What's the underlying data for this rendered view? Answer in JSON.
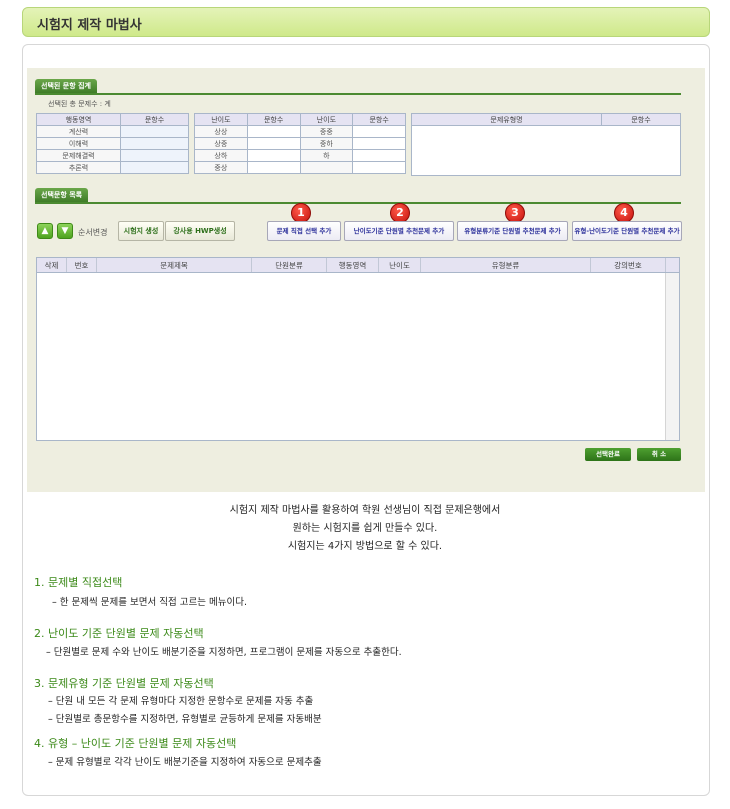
{
  "header": {
    "title": "시험지 제작 마법사"
  },
  "summary": {
    "tab_label": "선택된 문항 집계",
    "total_label": "선택된 총 문제수 : 계",
    "table1": {
      "headers": [
        "행동영역",
        "문항수"
      ],
      "rows": [
        "계산력",
        "이해력",
        "문제해결력",
        "추론력"
      ]
    },
    "table2": {
      "headers": [
        "난이도",
        "문항수",
        "난이도",
        "문항수"
      ],
      "rows": [
        [
          "상상",
          "",
          "중중",
          ""
        ],
        [
          "상중",
          "",
          "중하",
          ""
        ],
        [
          "상하",
          "",
          "하",
          ""
        ],
        [
          "중상",
          "",
          "",
          ""
        ]
      ]
    },
    "table3": {
      "headers": [
        "문제유형명",
        "문항수"
      ]
    }
  },
  "list": {
    "tab_label": "선택문항 목록",
    "order_label": "순서변경",
    "gen_button": "시험지 생성",
    "hwp_button": "강사용 HWP생성",
    "add_buttons": [
      {
        "num": "1",
        "label": "문제 직접 선택 추가"
      },
      {
        "num": "2",
        "label": "난이도기준 단원별 추천문제 추가"
      },
      {
        "num": "3",
        "label": "유형분류기준 단원별 추천문제 추가"
      },
      {
        "num": "4",
        "label": "유형-난이도기준 단원별 추천문제 추가"
      }
    ],
    "columns": [
      "삭제",
      "번호",
      "문제제목",
      "단원분류",
      "행동영역",
      "난이도",
      "유형분류",
      "강의번호"
    ],
    "confirm_button": "선택완료",
    "cancel_button": "취 소"
  },
  "intro": [
    "시험지 제작 마법사를 활용하여 학원 선생님이 직접 문제은행에서",
    "원하는 시험지를 쉽게 만들수 있다.",
    "시험지는 4가지 방법으로 할 수 있다."
  ],
  "methods": [
    {
      "title": "1.  문제별 직접선택",
      "desc": [
        "– 한 문제씩 문제를 보면서 직접 고르는 메뉴이다."
      ]
    },
    {
      "title": "2. 난이도 기준 단원별 문제 자동선택",
      "desc": [
        "– 단원별로 문제 수와 난이도 배분기준을 지정하면,  프로그램이 문제를 자동으로 추출한다."
      ]
    },
    {
      "title": "3. 문제유형 기준 단원별 문제 자동선택",
      "desc": [
        "– 단원 내 모든 각 문제 유형마다 지정한 문항수로 문제를 자동 추출",
        "– 단원별로 총문항수를 지정하면, 유형별로 균등하게 문제를 자동배분"
      ]
    },
    {
      "title": "4. 유형 – 난이도 기준 단원별 문제 자동선택",
      "desc": [
        "– 문제 유형별로 각각 난이도 배분기준을 지정하여 자동으로 문제추출"
      ]
    }
  ]
}
